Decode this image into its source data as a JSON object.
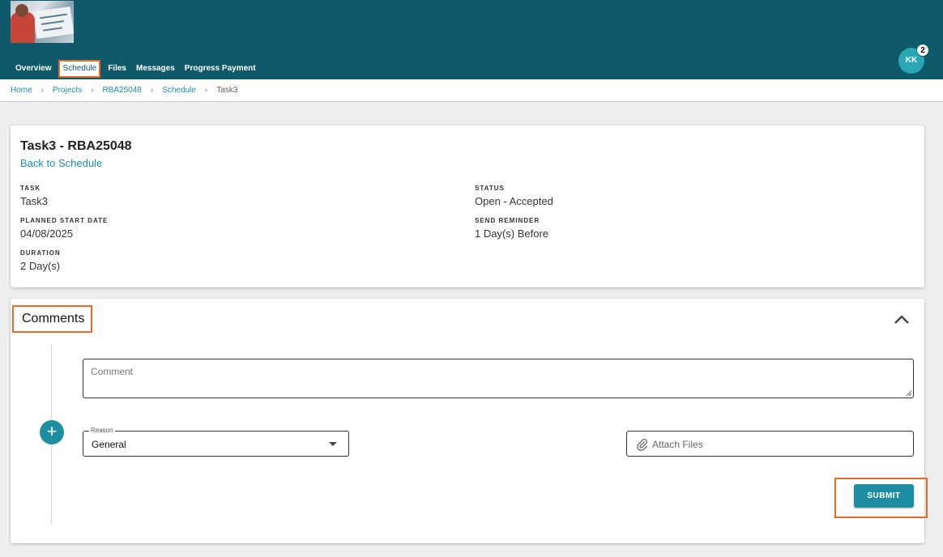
{
  "header": {
    "nav": [
      {
        "label": "Overview"
      },
      {
        "label": "Schedule"
      },
      {
        "label": "Files"
      },
      {
        "label": "Messages"
      },
      {
        "label": "Progress Payment"
      }
    ],
    "active_nav": "Schedule",
    "avatar_initials": "KK",
    "notification_count": "2",
    "brand_color": "#0e5a6b",
    "accent_color": "#1e8fa2",
    "highlight_color": "#e8692a"
  },
  "breadcrumb": [
    "Home",
    "Projects",
    "RBA25048",
    "Schedule",
    "Task3"
  ],
  "task_card": {
    "title": "Task3 - RBA25048",
    "back_link": "Back to Schedule",
    "fields": {
      "task": {
        "label": "TASK",
        "value": "Task3"
      },
      "planned_start": {
        "label": "PLANNED START DATE",
        "value": "04/08/2025"
      },
      "duration": {
        "label": "DURATION",
        "value": "2 Day(s)"
      },
      "status": {
        "label": "STATUS",
        "value": "Open - Accepted"
      },
      "reminder": {
        "label": "SEND REMINDER",
        "value": "1 Day(s) Before"
      }
    }
  },
  "comments": {
    "title": "Comments",
    "comment_placeholder": "Comment",
    "reason_label": "Reason",
    "reason_value": "General",
    "attach_label": "Attach Files",
    "submit_label": "SUBMIT",
    "icons": {
      "collapse": "chevron-up-icon",
      "add": "plus-icon",
      "attach": "paperclip-icon",
      "dropdown": "caret-down-icon"
    }
  }
}
